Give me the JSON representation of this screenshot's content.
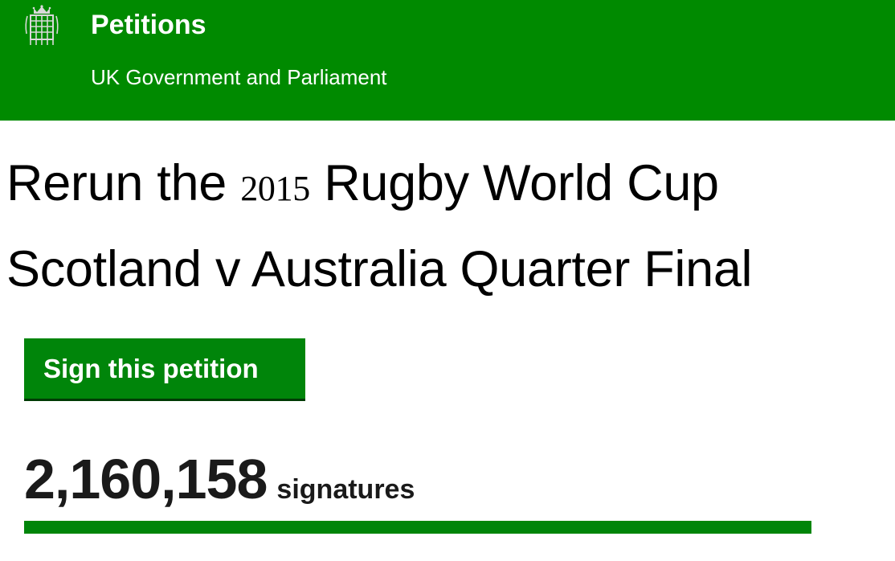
{
  "header": {
    "logo_icon": "portcullis-icon",
    "title": "Petitions",
    "subtitle": "UK Government and Parliament",
    "background_color": "#008a00"
  },
  "petition": {
    "title_line1_a": "Rerun the",
    "title_line1_year": "2015",
    "title_line1_b": "Rugby World Cup",
    "title_line2": "Scotland v Australia Quarter Final"
  },
  "sign_button": {
    "label": "Sign this petition",
    "color": "#00850a"
  },
  "signatures": {
    "count": "2,160,158",
    "label": "signatures",
    "progress_percent": 100
  }
}
